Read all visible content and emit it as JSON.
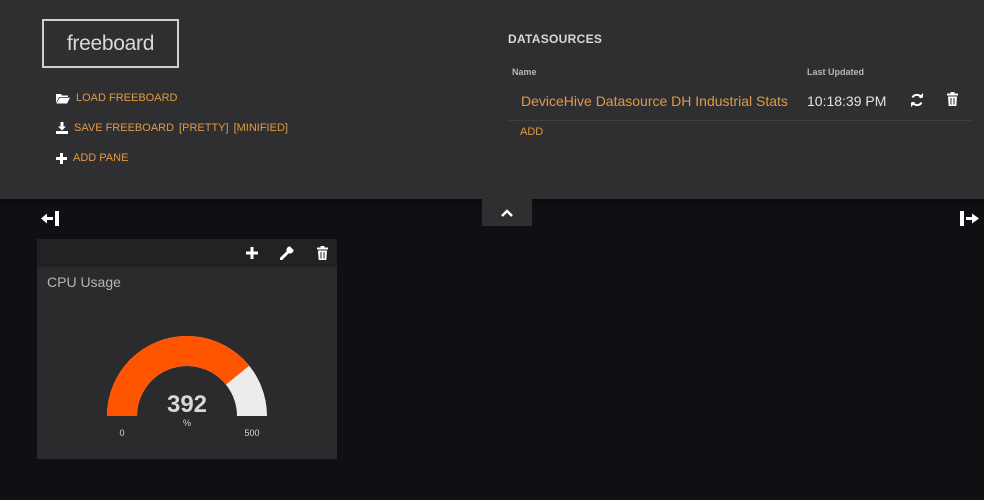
{
  "header": {
    "logo": "freeboard",
    "actions": {
      "load": "LOAD FREEBOARD",
      "save": "SAVE FREEBOARD",
      "save_pretty": "[PRETTY]",
      "save_minified": "[MINIFIED]",
      "add_pane": "ADD PANE"
    },
    "icons": {
      "load": "folder-open-icon",
      "save": "download-icon",
      "add_pane": "plus-icon"
    }
  },
  "datasources": {
    "title": "DATASOURCES",
    "columns": {
      "name": "Name",
      "last_updated": "Last Updated"
    },
    "rows": [
      {
        "name": "DeviceHive Datasource DH Industrial Stats",
        "last_updated": "10:18:39 PM",
        "icons": [
          "refresh-icon",
          "trash-icon"
        ]
      }
    ],
    "add_label": "ADD"
  },
  "toolbar": {
    "toggle_header_icon": "chevron-up-icon",
    "remove_column_icon": "column-shrink-icon",
    "add_column_icon": "column-expand-icon"
  },
  "panes": [
    {
      "title": "CPU Usage",
      "tools": [
        "plus-icon",
        "wrench-icon",
        "trash-icon"
      ],
      "gauge": {
        "value": 392,
        "units": "%",
        "min": 0,
        "max": 500,
        "fill_color": "#ff5500",
        "track_color": "#ececec"
      }
    }
  ],
  "colors": {
    "accent": "#e09a47",
    "header_bg": "#2f2f31",
    "board_bg": "#101014",
    "pane_bg": "#2b2b2d"
  }
}
